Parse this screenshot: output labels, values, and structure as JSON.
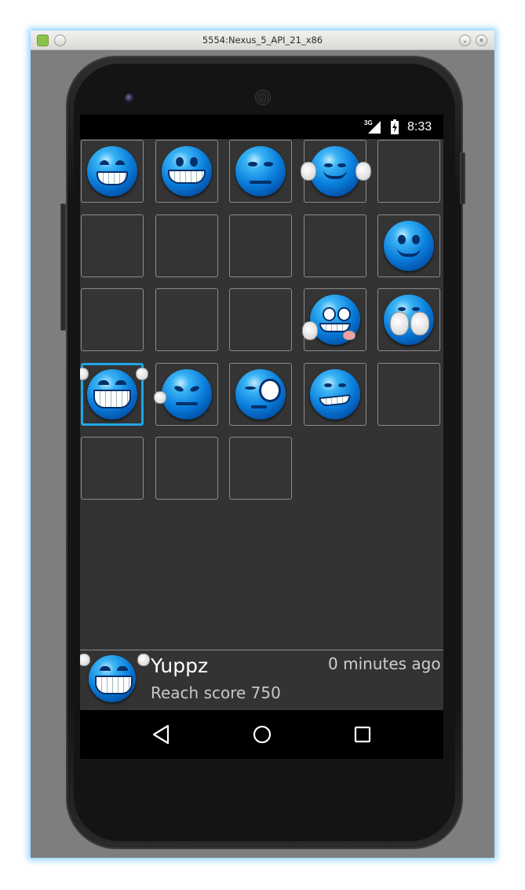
{
  "window": {
    "title": "5554:Nexus_5_API_21_x86"
  },
  "status_bar": {
    "network": "3G",
    "time": "8:33"
  },
  "grid": {
    "selected_cell": 15,
    "cells": [
      {
        "emoji": "crying-face"
      },
      {
        "emoji": "grinning-teeth-face"
      },
      {
        "emoji": "annoyed-face"
      },
      {
        "emoji": "clapping-face"
      },
      {
        "emoji": null
      },
      {
        "emoji": null
      },
      {
        "emoji": null
      },
      {
        "emoji": null
      },
      {
        "emoji": null
      },
      {
        "emoji": "smiling-face"
      },
      {
        "emoji": null
      },
      {
        "emoji": null
      },
      {
        "emoji": null
      },
      {
        "emoji": "scared-face"
      },
      {
        "emoji": "hiding-face"
      },
      {
        "emoji": "laughing-face"
      },
      {
        "emoji": "angry-face"
      },
      {
        "emoji": "winking-face"
      },
      {
        "emoji": "grimacing-face"
      },
      {
        "emoji": null
      },
      {
        "emoji": null
      },
      {
        "emoji": null
      },
      {
        "emoji": null
      }
    ]
  },
  "notification": {
    "icon": "laughing-face",
    "title": "Yuppz",
    "time": "0 minutes ago",
    "message": "Reach score 750"
  },
  "nav_bar": {
    "buttons": [
      "back-icon",
      "home-icon",
      "recents-icon"
    ]
  },
  "colors": {
    "selection": "#1ea6e6",
    "screen_bg": "#333333",
    "emoji_blue": "#0a7fdc"
  }
}
